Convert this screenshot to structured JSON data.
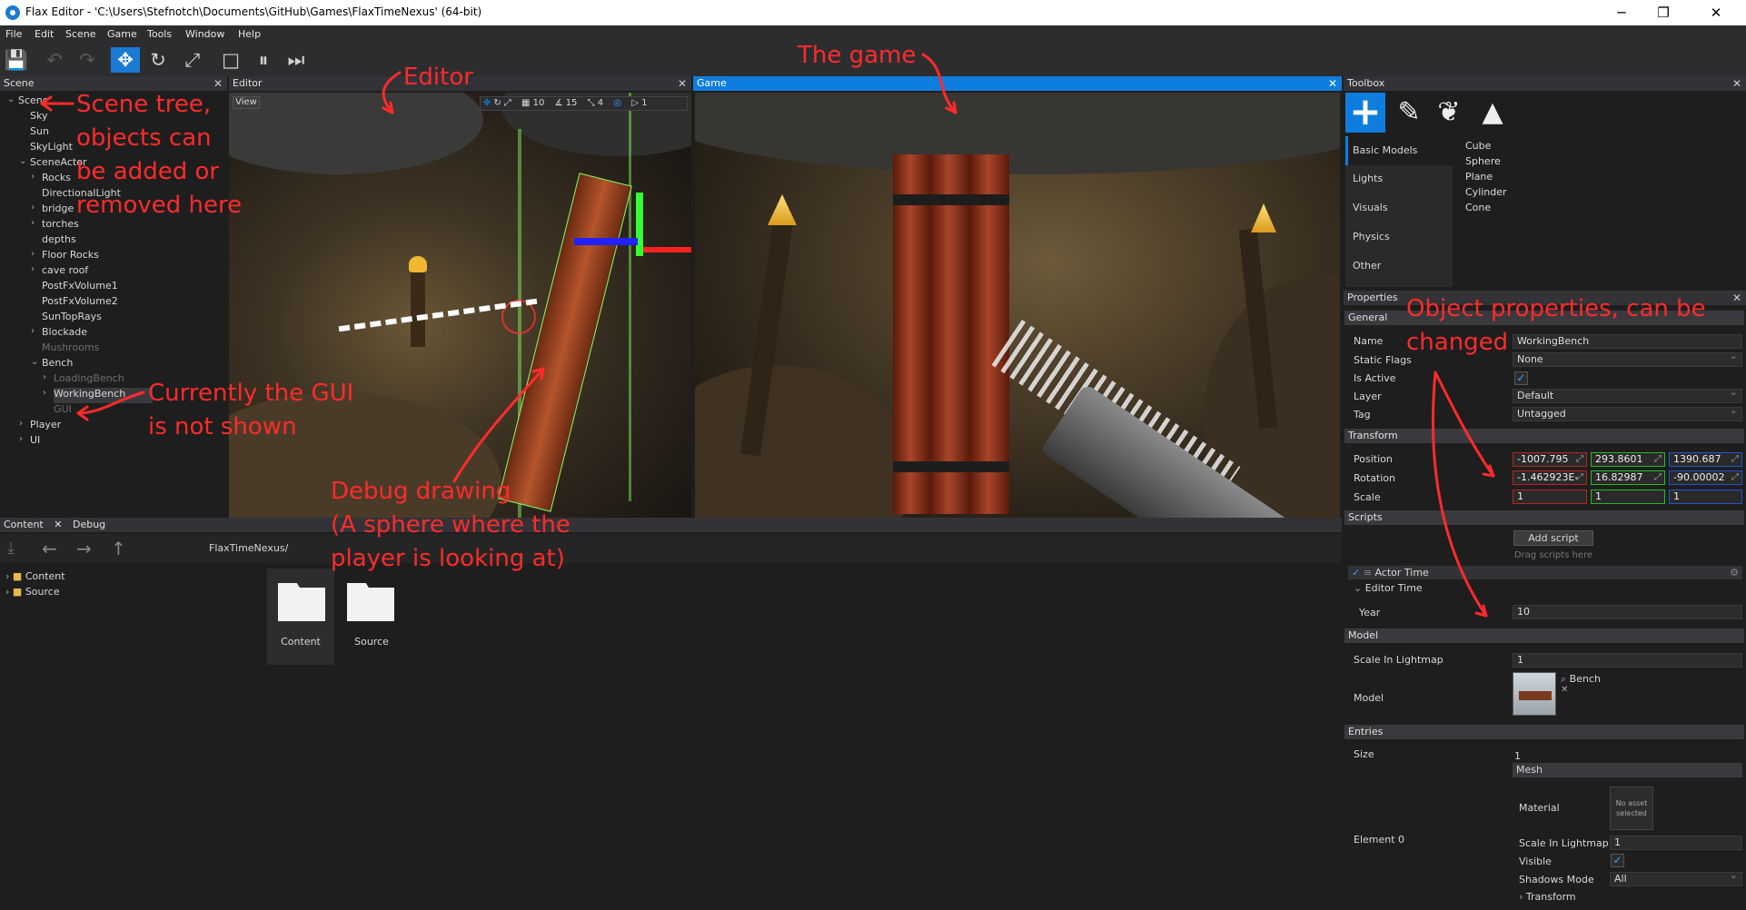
{
  "window": {
    "title": "Flax Editor - 'C:\\Users\\Stefnotch\\Documents\\GitHub\\Games\\FlaxTimeNexus' (64-bit)",
    "minimize": "─",
    "maximize": "❐",
    "close": "✕"
  },
  "menu": [
    "File",
    "Edit",
    "Scene",
    "Game",
    "Tools",
    "Window",
    "Help"
  ],
  "toolbar": {
    "icons": [
      "save-icon",
      "undo-icon",
      "redo-icon",
      "translate-icon",
      "rotate-icon",
      "scale-icon",
      "stop-icon",
      "pause-icon",
      "step-icon"
    ],
    "glyphs": {
      "save": "💾",
      "undo": "↶",
      "redo": "↷",
      "translate": "✥",
      "rotate": "↻",
      "scale": "⤢",
      "stop": "□",
      "pause": "⏸",
      "step": "⏭"
    }
  },
  "scene": {
    "header": "Scene",
    "close": "✕",
    "tree": [
      {
        "label": "Scene",
        "level": 0,
        "expanded": true
      },
      {
        "label": "Sky",
        "level": 1
      },
      {
        "label": "Sun",
        "level": 1
      },
      {
        "label": "SkyLight",
        "level": 1
      },
      {
        "label": "SceneActor",
        "level": 1,
        "expanded": true
      },
      {
        "label": "Rocks",
        "level": 2,
        "collapsed": true
      },
      {
        "label": "DirectionalLight",
        "level": 2
      },
      {
        "label": "bridge",
        "level": 2,
        "collapsed": true
      },
      {
        "label": "torches",
        "level": 2,
        "collapsed": true
      },
      {
        "label": "depths",
        "level": 2
      },
      {
        "label": "Floor Rocks",
        "level": 2,
        "collapsed": true
      },
      {
        "label": "cave roof",
        "level": 2,
        "collapsed": true
      },
      {
        "label": "PostFxVolume1",
        "level": 2
      },
      {
        "label": "PostFxVolume2",
        "level": 2
      },
      {
        "label": "SunTopRays",
        "level": 2
      },
      {
        "label": "Blockade",
        "level": 2,
        "collapsed": true
      },
      {
        "label": "Mushrooms",
        "level": 2,
        "dim": true
      },
      {
        "label": "Bench",
        "level": 2,
        "expanded": true
      },
      {
        "label": "LoadingBench",
        "level": 3,
        "collapsed": true,
        "dim": true
      },
      {
        "label": "WorkingBench",
        "level": 3,
        "collapsed": true,
        "selected": true
      },
      {
        "label": "GUI",
        "level": 3,
        "dim": true
      },
      {
        "label": "Player",
        "level": 1,
        "collapsed": true
      },
      {
        "label": "UI",
        "level": 1,
        "collapsed": true
      }
    ]
  },
  "editor": {
    "header": "Editor",
    "close": "✕",
    "view_button": "View",
    "gizmo": [
      "10",
      "15",
      "4",
      "1"
    ]
  },
  "game": {
    "header": "Game",
    "close": "✕"
  },
  "content": {
    "tabs": [
      "Content",
      "Debug"
    ],
    "close": "✕",
    "path": "FlaxTimeNexus/",
    "tree": [
      "Content",
      "Source"
    ],
    "folders": [
      "Content",
      "Source"
    ]
  },
  "toolbox": {
    "header": "Toolbox",
    "close": "✕",
    "categories": [
      "Basic Models",
      "Lights",
      "Visuals",
      "Physics",
      "Other"
    ],
    "items": [
      "Cube",
      "Sphere",
      "Plane",
      "Cylinder",
      "Cone"
    ]
  },
  "properties": {
    "header": "Properties",
    "close": "✕",
    "general": {
      "title": "General",
      "name_label": "Name",
      "name": "WorkingBench",
      "static_flags_label": "Static Flags",
      "static_flags": "None",
      "is_active_label": "Is Active",
      "layer_label": "Layer",
      "layer": "Default",
      "tag_label": "Tag",
      "tag": "Untagged"
    },
    "transform": {
      "title": "Transform",
      "position_label": "Position",
      "position": [
        "-1007.795",
        "293.8601",
        "1390.687"
      ],
      "rotation_label": "Rotation",
      "rotation": [
        "-1.462923E-",
        "16.82987",
        "-90.00002"
      ],
      "scale_label": "Scale",
      "scale": [
        "1",
        "1",
        "1"
      ]
    },
    "scripts": {
      "title": "Scripts",
      "add_button": "Add script",
      "drag_hint": "Drag scripts here",
      "actor_time": "Actor Time",
      "editor_time": "Editor Time",
      "year_label": "Year",
      "year": "10"
    },
    "model": {
      "title": "Model",
      "scale_label": "Scale In Lightmap",
      "scale": "1",
      "model_label": "Model",
      "model_name": "Bench"
    },
    "entries": {
      "title": "Entries",
      "size_label": "Size",
      "size": "1",
      "element_label": "Element 0",
      "mesh": "Mesh",
      "material_label": "Material",
      "material_value": "No asset selected",
      "lightmap_label": "Scale In Lightmap",
      "lightmap": "1",
      "visible_label": "Visible",
      "shadows_label": "Shadows Mode",
      "shadows": "All",
      "transform_label": "Transform"
    }
  },
  "annotations": {
    "scene_tree": [
      "Scene tree,",
      "objects can",
      "be added or",
      "removed here"
    ],
    "gui": [
      "Currently the GUI",
      "is not shown"
    ],
    "editor": "Editor",
    "game": "The game",
    "debug": [
      "Debug drawing",
      "(A sphere where the",
      "player is looking at)"
    ],
    "props": [
      "Object properties, can be",
      "changed"
    ]
  },
  "colors": {
    "accent": "#0f7dde",
    "annotation": "#ff2b2b",
    "panel": "#1e1e1e",
    "header": "#333337"
  }
}
